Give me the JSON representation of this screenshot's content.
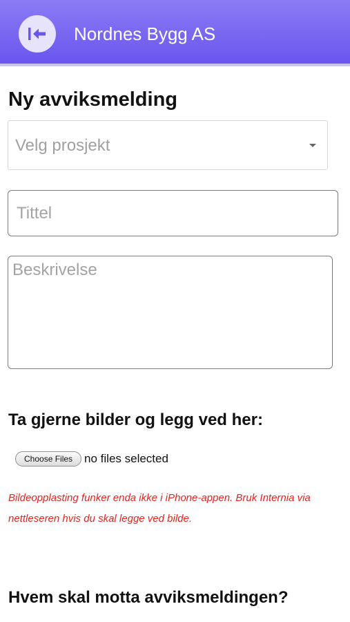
{
  "header": {
    "title": "Nordnes Bygg AS",
    "back_icon": "back-arrow-icon",
    "colors": {
      "gradient_top": "#8a7cf5",
      "gradient_bottom": "#6a56ee"
    }
  },
  "form": {
    "title": "Ny avviksmelding",
    "project_select": {
      "selected": "Velg prosjekt"
    },
    "title_field": {
      "placeholder": "Tittel",
      "value": ""
    },
    "description_field": {
      "placeholder": "Beskrivelse",
      "value": ""
    },
    "upload": {
      "heading": "Ta gjerne bilder og legg ved her:",
      "button_label": "Choose Files",
      "status": "no files selected",
      "warning": "Bildeopplasting funker enda ikke i iPhone-appen. Bruk Internia via nettleseren hvis du skal legge ved bilde.",
      "warning_color": "#e8221d"
    },
    "recipients": {
      "heading": "Hvem skal motta avviksmeldingen?"
    }
  }
}
